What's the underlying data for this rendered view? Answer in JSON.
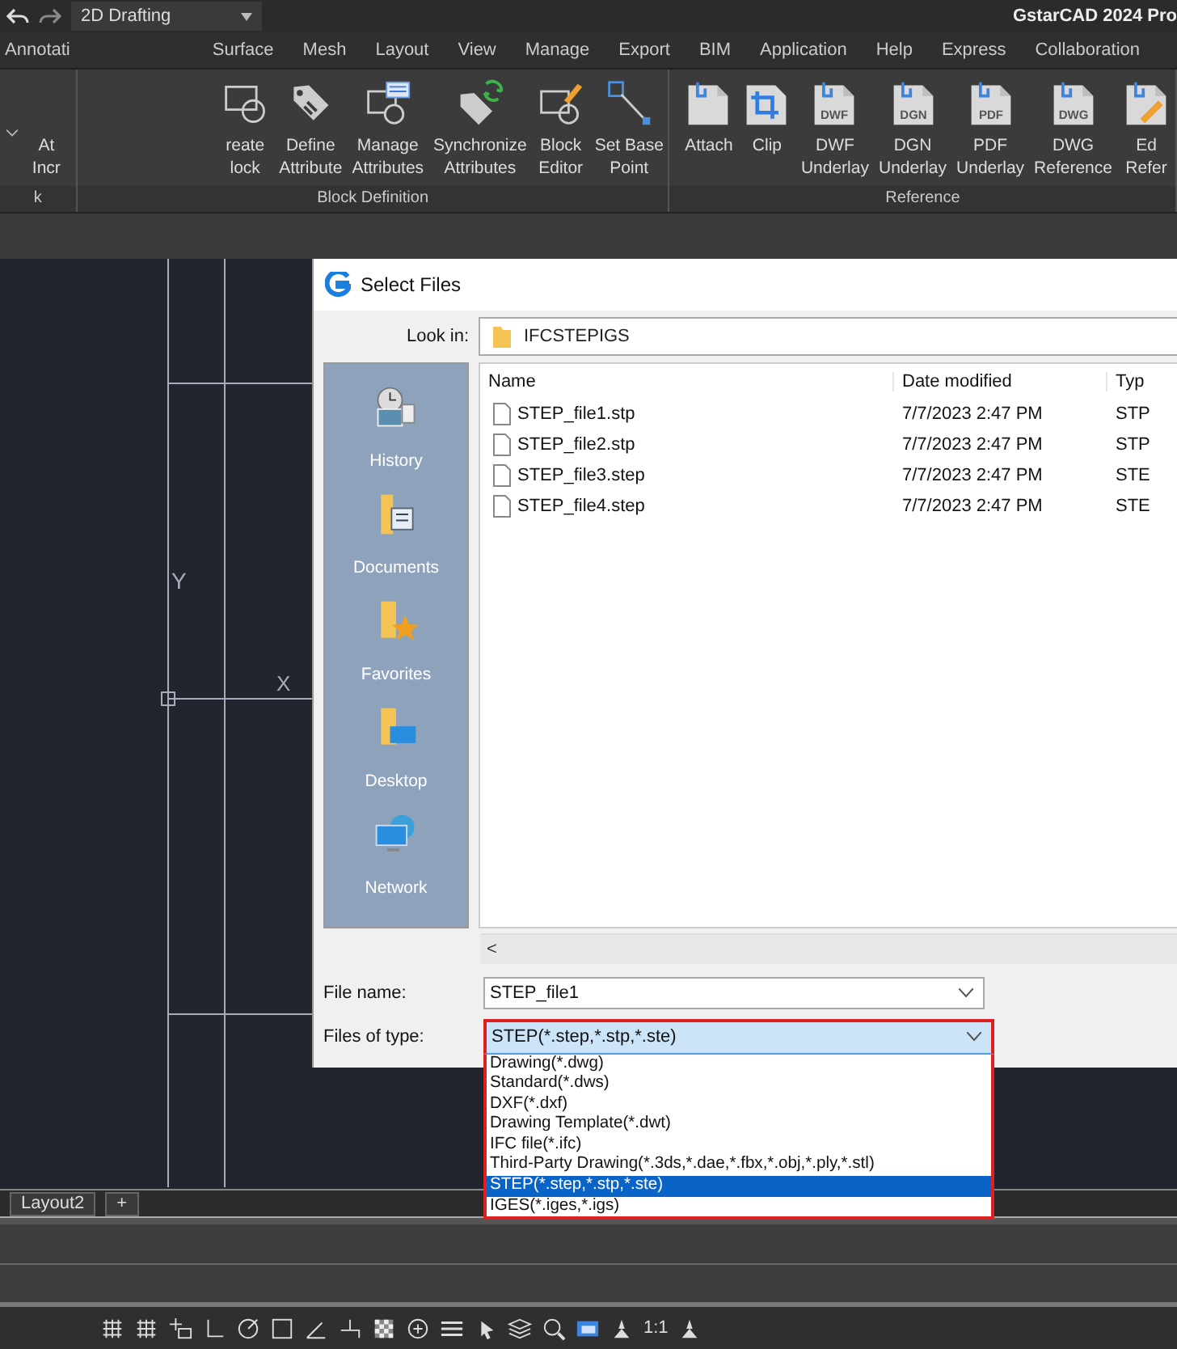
{
  "title_bar": {
    "workspace": "2D Drafting",
    "title": "GstarCAD 2024 Pro"
  },
  "ribbon_tabs": [
    {
      "label": "Annotati",
      "selected": false
    },
    {
      "label": "Surface",
      "selected": false
    },
    {
      "label": "Mesh",
      "selected": false
    },
    {
      "label": "Layout",
      "selected": false
    },
    {
      "label": "View",
      "selected": false
    },
    {
      "label": "Manage",
      "selected": false
    },
    {
      "label": "Export",
      "selected": false
    },
    {
      "label": "BIM",
      "selected": false
    },
    {
      "label": "Application",
      "selected": false
    },
    {
      "label": "Help",
      "selected": false
    },
    {
      "label": "Express",
      "selected": false
    },
    {
      "label": "Collaboration",
      "selected": false
    }
  ],
  "ribbon_panels": [
    {
      "label": "k",
      "buttons": [
        {
          "kind": "blank",
          "lines": [
            "At",
            "Incr"
          ]
        }
      ]
    },
    {
      "label": "Block Definition",
      "buttons": [
        {
          "kind": "block",
          "lines": [
            "reate",
            "lock"
          ]
        },
        {
          "kind": "tag",
          "lines": [
            "Define",
            "Attribute"
          ]
        },
        {
          "kind": "manage",
          "lines": [
            "Manage",
            "Attributes"
          ]
        },
        {
          "kind": "sync",
          "lines": [
            "Synchronize",
            "Attributes"
          ]
        },
        {
          "kind": "editor",
          "lines": [
            "Block",
            "Editor"
          ]
        },
        {
          "kind": "basepoint",
          "lines": [
            "Set Base",
            "Point"
          ]
        }
      ]
    },
    {
      "label": "Reference",
      "buttons": [
        {
          "kind": "doc",
          "lines": [
            "Attach"
          ]
        },
        {
          "kind": "clip",
          "lines": [
            "Clip"
          ]
        },
        {
          "kind": "doc",
          "badge": "DWF",
          "lines": [
            "DWF",
            "Underlay"
          ]
        },
        {
          "kind": "doc",
          "badge": "DGN",
          "lines": [
            "DGN",
            "Underlay"
          ]
        },
        {
          "kind": "doc",
          "badge": "PDF",
          "lines": [
            "PDF",
            "Underlay"
          ]
        },
        {
          "kind": "doc",
          "badge": "DWG",
          "lines": [
            "DWG",
            "Reference"
          ]
        },
        {
          "kind": "docedit",
          "lines": [
            "Ed",
            "Refer"
          ]
        }
      ]
    }
  ],
  "ucs": {
    "y_label": "Y",
    "x_label": "X"
  },
  "dialog": {
    "title": "Select Files",
    "look_in_label": "Look in:",
    "look_in": "IFCSTEPIGS",
    "places": [
      {
        "label": "History",
        "selected": false
      },
      {
        "label": "Documents",
        "selected": false
      },
      {
        "label": "Favorites",
        "selected": false
      },
      {
        "label": "Desktop",
        "selected": false
      },
      {
        "label": "Network",
        "selected": false
      }
    ],
    "columns": [
      "Name",
      "Date modified",
      "Typ"
    ],
    "files": [
      {
        "name": "STEP_file1.stp",
        "date": "7/7/2023 2:47 PM",
        "type": "STP"
      },
      {
        "name": "STEP_file2.stp",
        "date": "7/7/2023 2:47 PM",
        "type": "STP"
      },
      {
        "name": "STEP_file3.step",
        "date": "7/7/2023 2:47 PM",
        "type": "STE"
      },
      {
        "name": "STEP_file4.step",
        "date": "7/7/2023 2:47 PM",
        "type": "STE"
      }
    ],
    "scroll_left": "<",
    "file_name_label": "File name:",
    "file_name": "STEP_file1",
    "file_type_label": "Files of type:",
    "file_type": "STEP(*.step,*.stp,*.ste)",
    "type_options": [
      {
        "label": "Drawing(*.dwg)",
        "selected": false
      },
      {
        "label": "Standard(*.dws)",
        "selected": false
      },
      {
        "label": "DXF(*.dxf)",
        "selected": false
      },
      {
        "label": "Drawing Template(*.dwt)",
        "selected": false
      },
      {
        "label": "IFC file(*.ifc)",
        "selected": false
      },
      {
        "label": "Third-Party Drawing(*.3ds,*.dae,*.fbx,*.obj,*.ply,*.stl)",
        "selected": false
      },
      {
        "label": "STEP(*.step,*.stp,*.ste)",
        "selected": true
      },
      {
        "label": "IGES(*.iges,*.igs)",
        "selected": false
      }
    ]
  },
  "layout_tabs": [
    {
      "label": "Layout2"
    },
    {
      "label": "+"
    }
  ],
  "status_bar": {
    "scale": "1:1"
  }
}
